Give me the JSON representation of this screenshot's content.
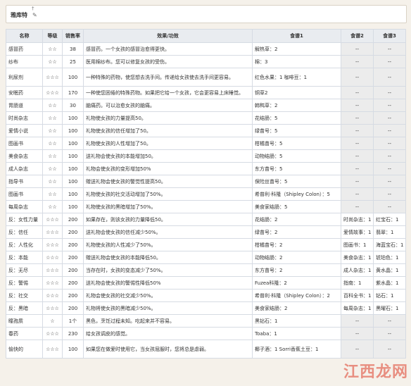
{
  "page_title": "雅库特",
  "columns": [
    "名称",
    "等级",
    "销售率",
    "效果/功效",
    "食谱1",
    "食谱2",
    "食谱3"
  ],
  "rows": [
    {
      "name": "感冒药",
      "grade": "☆☆",
      "rate": "38",
      "effect": "感冒药。一个女孩的感冒治愈得更快。",
      "r1": "解热草：2",
      "r2": "--",
      "r3": "--"
    },
    {
      "name": "纱布",
      "grade": "☆☆",
      "rate": "25",
      "effect": "医用棉纱布。您可以修复女孩的受伤。",
      "r1": "棉：3",
      "r2": "--",
      "r3": "--"
    },
    {
      "name": "利尿剂",
      "grade": "☆☆☆",
      "rate": "100",
      "effect": "一种特殊的药物，使您想去洗手间。传递给女孩使去洗手间更容易。",
      "r1": "红色水果：1\n咖啡豆：1",
      "r2": "--",
      "r3": "--"
    },
    {
      "name": "安眠药",
      "grade": "☆☆☆",
      "rate": "170",
      "effect": "一种使您困倦的特殊药物。如果把它给一个女孩，它会更容易上床睡觉。",
      "r1": "铜草2",
      "r2": "--",
      "r3": "--"
    },
    {
      "name": "胃肠道",
      "grade": "☆☆",
      "rate": "30",
      "effect": "脑痛药。可以治愈女孩的脑痛。",
      "r1": "韩鸭草：2",
      "r2": "--",
      "r3": "--"
    },
    {
      "name": "时尚杂志",
      "grade": "☆☆",
      "rate": "100",
      "effect": "礼物使女孩的力量提高50。",
      "r1": "花结肠：5",
      "r2": "--",
      "r3": "--"
    },
    {
      "name": "爱情小说",
      "grade": "☆☆",
      "rate": "100",
      "effect": "礼物使女孩的信任增加了50。",
      "r1": "绿苗号：5",
      "r2": "--",
      "r3": "--"
    },
    {
      "name": "图画书",
      "grade": "☆☆",
      "rate": "100",
      "effect": "礼物使女孩的人性增加了50。",
      "r1": "柑橘苗号：5",
      "r2": "--",
      "r3": "--"
    },
    {
      "name": "美食杂志",
      "grade": "☆☆",
      "rate": "100",
      "effect": "送礼物会使女孩的本能增加50。",
      "r1": "动物结肠：5",
      "r2": "--",
      "r3": "--"
    },
    {
      "name": "成人杂志",
      "grade": "☆☆",
      "rate": "100",
      "effect": "礼物会使女孩的变形增加50%",
      "r1": "东方苗号：5",
      "r2": "--",
      "r3": "--"
    },
    {
      "name": "指导书",
      "grade": "☆☆",
      "rate": "100",
      "effect": "赠送礼物会使女孩的警觉性提高50。",
      "r1": "保险丝苗号：5",
      "r2": "--",
      "r3": "--"
    },
    {
      "name": "图画书",
      "grade": "☆☆",
      "rate": "100",
      "effect": "礼物使女孩的社交活动增加了50%。",
      "r1": "希普利·科隆（Shipley Colon）：5",
      "r2": "--",
      "r3": "--"
    },
    {
      "name": "每周杂志",
      "grade": "☆☆",
      "rate": "100",
      "effect": "礼物使女孩的黑暗增加了50%。",
      "r1": "美食家结肠：5",
      "r2": "--",
      "r3": "--"
    },
    {
      "name": "反：女性力量",
      "grade": "☆☆☆",
      "rate": "200",
      "effect": "如果存在，则该女孩的力量降低50。",
      "r1": "花结肠：2",
      "r2": "时尚杂志：1",
      "r3": "红宝石：1"
    },
    {
      "name": "反：信任",
      "grade": "☆☆☆",
      "rate": "200",
      "effect": "送礼物会使女孩的信任减少50%。",
      "r1": "绿苗号：2",
      "r2": "爱情故事：1",
      "r3": "翡翠：1"
    },
    {
      "name": "反：人性化",
      "grade": "☆☆☆",
      "rate": "200",
      "effect": "礼物使女孩的人性减少了50%。",
      "r1": "柑橘苗号：2",
      "r2": "图画书：1",
      "r3": "海蓝宝石：1"
    },
    {
      "name": "反：本能",
      "grade": "☆☆☆",
      "rate": "200",
      "effect": "赠送礼物会使女孩的本能降低50。",
      "r1": "动物结肠：2",
      "r2": "美食杂志：1",
      "r3": "琥珀色：1"
    },
    {
      "name": "反：无尽",
      "grade": "☆☆☆",
      "rate": "200",
      "effect": "当存在时，女孩的变态减少了50%。",
      "r1": "东方苗号：2",
      "r2": "成人杂志：1",
      "r3": "黄水晶：1"
    },
    {
      "name": "反：警惕",
      "grade": "☆☆☆",
      "rate": "200",
      "effect": "送礼物会使女孩的警惕性降低50%",
      "r1": "Fuzea科隆：2",
      "r2": "指南：1",
      "r3": "紫水晶：1"
    },
    {
      "name": "反：社交",
      "grade": "☆☆☆",
      "rate": "200",
      "effect": "礼物会使女孩的社交减少50%。",
      "r1": "希普利·科隆（Shipley Colon）：2",
      "r2": "百科全书：1",
      "r3": "钻石：1"
    },
    {
      "name": "反：黑暗",
      "grade": "☆☆☆",
      "rate": "200",
      "effect": "礼物将使女孩的黑暗减少50%。",
      "r1": "美食家结肠：2",
      "r2": "每周杂志：1",
      "r3": "黑曜石：1"
    },
    {
      "name": "瞳孢质",
      "grade": "☆",
      "rate": "1个",
      "effect": "黑色，烹饪过程未知。吃起来并不容易。",
      "r1": "黑钻石：1",
      "r2": "--",
      "r3": "--"
    },
    {
      "name": "春药",
      "grade": "☆☆☆",
      "rate": "230",
      "effect": "给女孩调皮的感觉。",
      "r1": "Toaba：1",
      "r2": "--",
      "r3": "--"
    },
    {
      "name": "愉快的",
      "grade": "☆☆☆",
      "rate": "100",
      "effect": "如果您在做爱时使用它，当女孩屈服时，您将总是虐弱。",
      "r1": "椰子酒：1\nSorri香蕉土豆：1",
      "r2": "--",
      "r3": "--"
    }
  ],
  "watermark": "江西龙网"
}
